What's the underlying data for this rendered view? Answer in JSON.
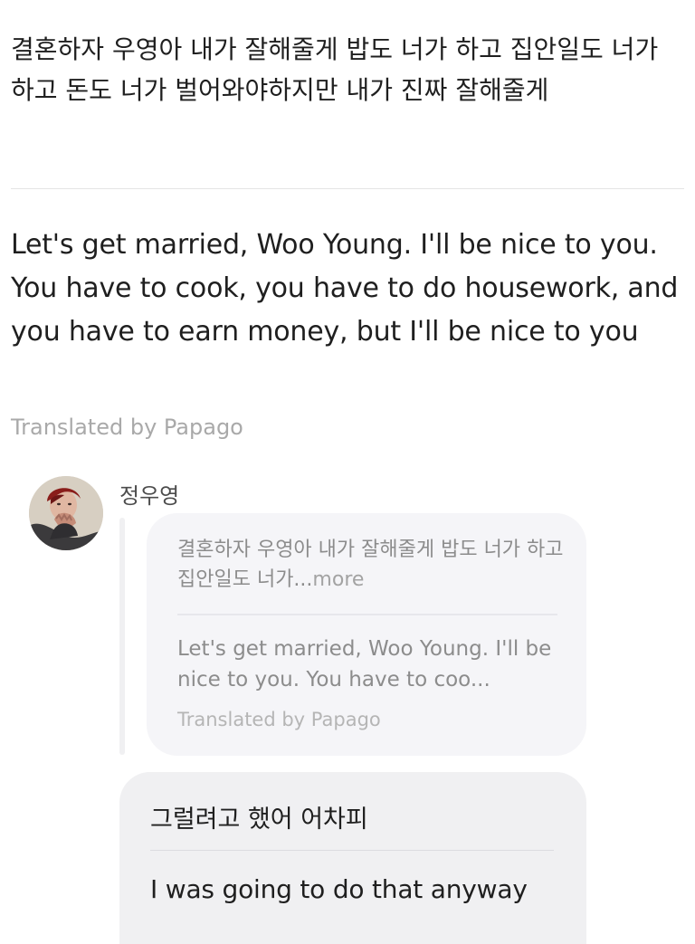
{
  "post": {
    "korean_text": "결혼하자 우영아 내가 잘해줄게 밥도 너가 하고 집안일도 너가 하고 돈도 너가 벌어와야하지만 내가 진짜 잘해줄게",
    "english_text": "Let's get married, Woo Young. I'll be nice to you. You have to cook, you have to do housework, and you have to earn money, but I'll be nice to you",
    "translated_label": "Translated by Papago"
  },
  "reply": {
    "username": "정우영",
    "quote": {
      "korean_text": "결혼하자 우영아 내가 잘해줄게 밥도 너가 하고 집안일도 너가...",
      "more_label": "more",
      "english_text": "Let's get married, Woo Young. I'll be nice to you. You have to coo...",
      "translated_label": "Translated by Papago"
    },
    "korean_text": "그럴려고 했어 어차피",
    "english_text": "I was going to do that anyway"
  },
  "colors": {
    "text_primary": "#1f1f1f",
    "text_muted": "#a9a9a9",
    "bubble_background": "#f0f0f2",
    "quote_background": "#f5f5f8"
  },
  "icons": {
    "avatar": "profile-photo"
  }
}
